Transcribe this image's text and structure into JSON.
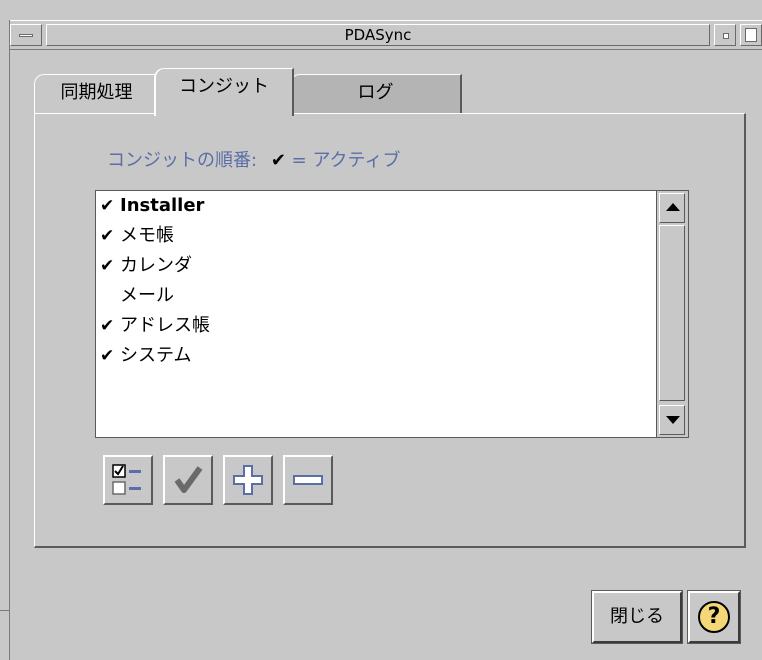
{
  "window": {
    "title": "PDASync"
  },
  "tabs": [
    {
      "label": "同期処理"
    },
    {
      "label": "コンジット"
    },
    {
      "label": "ログ"
    }
  ],
  "order_label": {
    "text": "コンジットの順番:",
    "check_symbol": "✔",
    "legend": "= アクティブ"
  },
  "conduits": [
    {
      "name": "Installer",
      "active": true,
      "check": "✔",
      "bold": true
    },
    {
      "name": "メモ帳",
      "active": true,
      "check": "✔",
      "bold": false
    },
    {
      "name": "カレンダ",
      "active": true,
      "check": "✔",
      "bold": false
    },
    {
      "name": "メール",
      "active": false,
      "check": "",
      "bold": false
    },
    {
      "name": "アドレス帳",
      "active": true,
      "check": "✔",
      "bold": false
    },
    {
      "name": "システム",
      "active": true,
      "check": "✔",
      "bold": false
    }
  ],
  "toolbar": {
    "icons": [
      "select-all-icon",
      "checkmark-icon",
      "plus-icon",
      "minus-icon"
    ]
  },
  "buttons": {
    "close_label": "閉じる",
    "help_label": "?"
  },
  "colors": {
    "background": "#c8c8c8",
    "label_blue": "#5b6ea8",
    "help_yellow": "#f4d878"
  }
}
